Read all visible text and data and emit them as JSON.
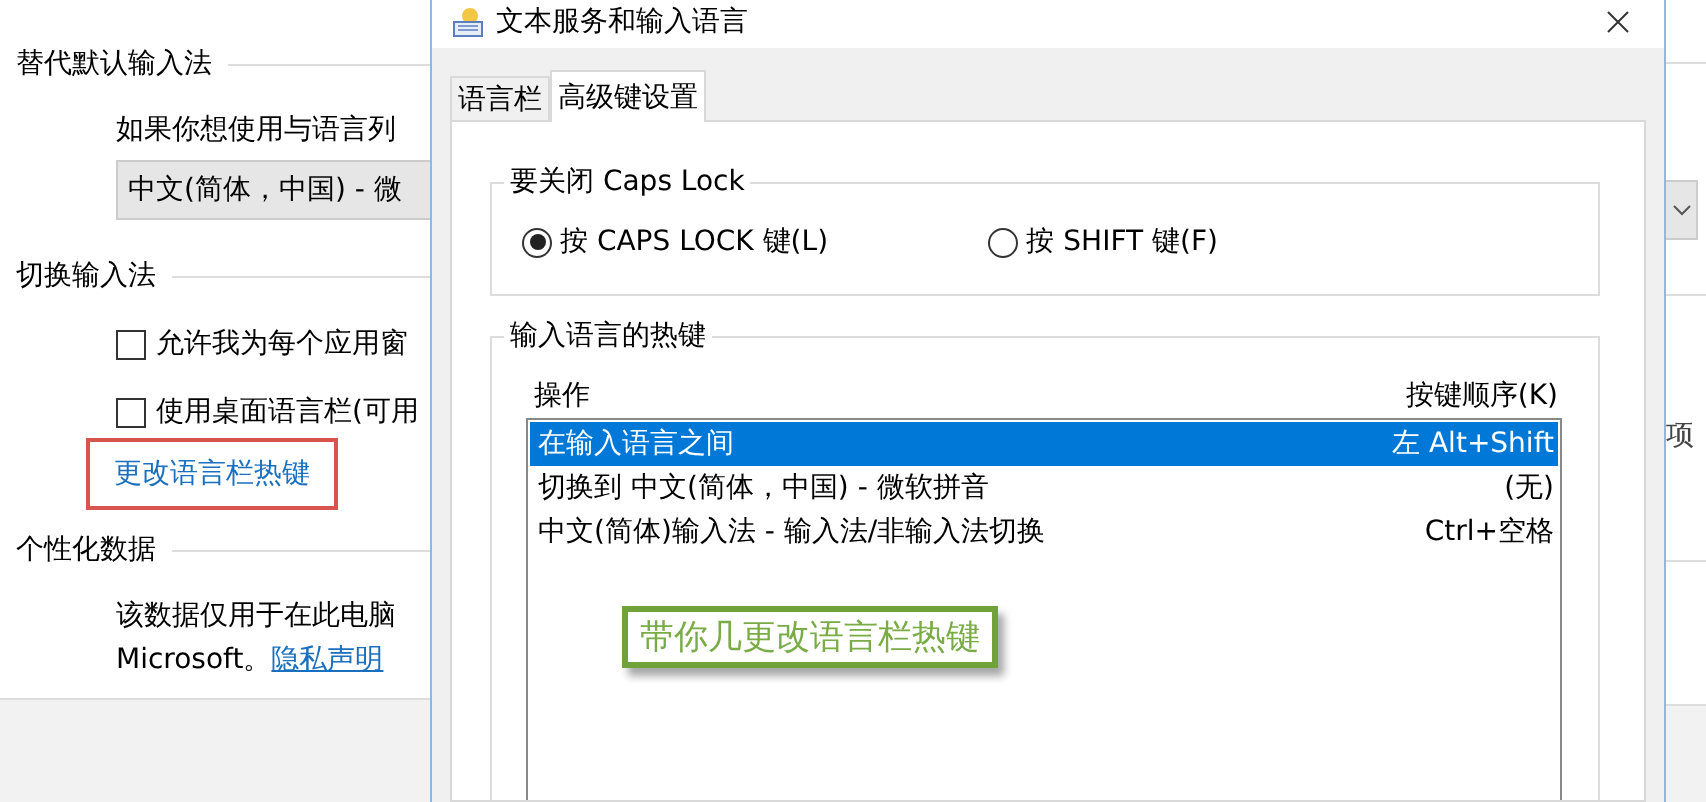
{
  "background_page": {
    "sections": [
      {
        "heading": "替代默认输入法",
        "items": [
          {
            "kind": "text",
            "text": "如果你想使用与语言列"
          },
          {
            "kind": "dropdown",
            "value": "中文(简体，中国) - 微"
          }
        ]
      },
      {
        "heading": "切换输入法",
        "items": [
          {
            "kind": "checkbox",
            "label": "允许我为每个应用窗",
            "checked": false
          },
          {
            "kind": "checkbox",
            "label": "使用桌面语言栏(可用",
            "checked": false
          },
          {
            "kind": "link",
            "text": "更改语言栏热键",
            "highlighted": true
          }
        ]
      },
      {
        "heading": "个性化数据",
        "items": [
          {
            "kind": "paragraph",
            "text": "该数据仅用于在此电脑",
            "prefix": "Microsoft。",
            "link": "隐私声明"
          }
        ]
      }
    ],
    "right_edge_text": "项"
  },
  "dialog": {
    "title": "文本服务和输入语言",
    "tabs": [
      {
        "label": "语言栏",
        "selected": false
      },
      {
        "label": "高级键设置",
        "selected": true
      }
    ],
    "caps_lock_group": {
      "title": "要关闭 Caps Lock",
      "options": [
        {
          "label": "按 CAPS LOCK 键(L)",
          "selected": true
        },
        {
          "label": "按 SHIFT 键(F)",
          "selected": false
        }
      ]
    },
    "hotkeys_group": {
      "title": "输入语言的热键",
      "columns": [
        "操作",
        "按键顺序(K)"
      ],
      "rows": [
        {
          "action": "在输入语言之间",
          "keys": "左 Alt+Shift",
          "selected": true
        },
        {
          "action": "切换到 中文(简体，中国) - 微软拼音",
          "keys": "(无)",
          "selected": false
        },
        {
          "action": "中文(简体)输入法 - 输入法/非输入法切换",
          "keys": "Ctrl+空格",
          "selected": false
        }
      ]
    },
    "annotation": "带你几更改语言栏热键"
  }
}
